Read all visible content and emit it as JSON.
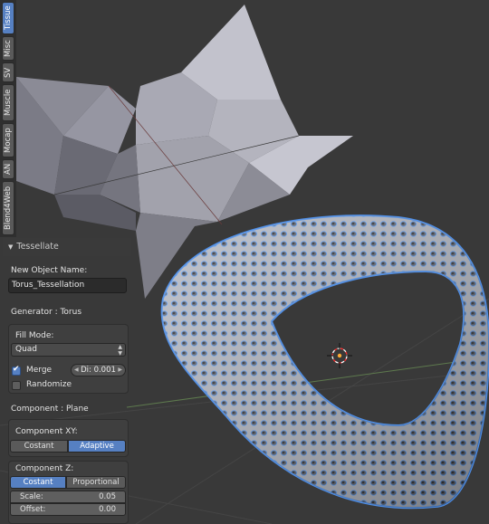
{
  "tabs": [
    {
      "label": "Tissue",
      "active": true
    },
    {
      "label": "Misc",
      "active": false
    },
    {
      "label": "SV",
      "active": false
    },
    {
      "label": "Muscle",
      "active": false
    },
    {
      "label": "Mocap",
      "active": false
    },
    {
      "label": "AN",
      "active": false
    },
    {
      "label": "Blend4Web",
      "active": false
    }
  ],
  "panel": {
    "title": "Tessellate",
    "new_object_name_label": "New Object Name:",
    "new_object_name_value": "Torus_Tessellation",
    "generator_label": "Generator : Torus",
    "fill_mode_label": "Fill Mode:",
    "fill_mode_value": "Quad",
    "merge_label": "Merge",
    "merge_checked": true,
    "merge_distance_label": "Di: 0.001",
    "randomize_label": "Randomize",
    "randomize_checked": false,
    "component_label": "Component : Plane",
    "component_xy_label": "Component XY:",
    "component_xy_options": [
      "Costant",
      "Adaptive"
    ],
    "component_xy_selected": "Adaptive",
    "component_z_label": "Component Z:",
    "component_z_options": [
      "Costant",
      "Proportional"
    ],
    "component_z_selected": "Costant",
    "scale_label": "Scale:",
    "scale_value": "0.05",
    "offset_label": "Offset:",
    "offset_value": "0.00"
  },
  "colors": {
    "accent": "#5680c2",
    "viewport_bg": "#393939",
    "selection_outline": "#4f8fe8"
  }
}
